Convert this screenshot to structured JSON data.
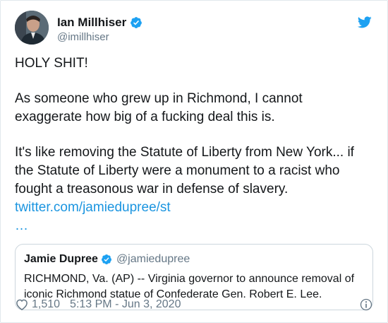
{
  "author": {
    "name": "Ian Millhiser",
    "handle": "@imillhiser"
  },
  "tweet": {
    "p1": "HOLY SHIT!",
    "p2": "As someone who grew up in Richmond, I cannot exaggerate how big of a fucking deal this is.",
    "p3": "It's like removing the Statute of Liberty from New York... if the Statute of Liberty were a monument to a racist who fought a treasonous war in defense of slavery.",
    "link": "twitter.com/jamiedupree/st",
    "ellipsis": "…"
  },
  "quote": {
    "name": "Jamie Dupree",
    "handle": "@jamiedupree",
    "text": "RICHMOND, Va. (AP) -- Virginia governor to announce removal of iconic Richmond statue of Confederate Gen. Robert E. Lee."
  },
  "footer": {
    "likes": "1,510",
    "timestamp": "5:13 PM - Jun 3, 2020"
  },
  "colors": {
    "link": "#1b95e0",
    "secondary": "#657786",
    "border": "#e1e8ed"
  },
  "icons": [
    "verified-badge-icon",
    "twitter-bird-icon",
    "heart-icon",
    "info-icon"
  ]
}
